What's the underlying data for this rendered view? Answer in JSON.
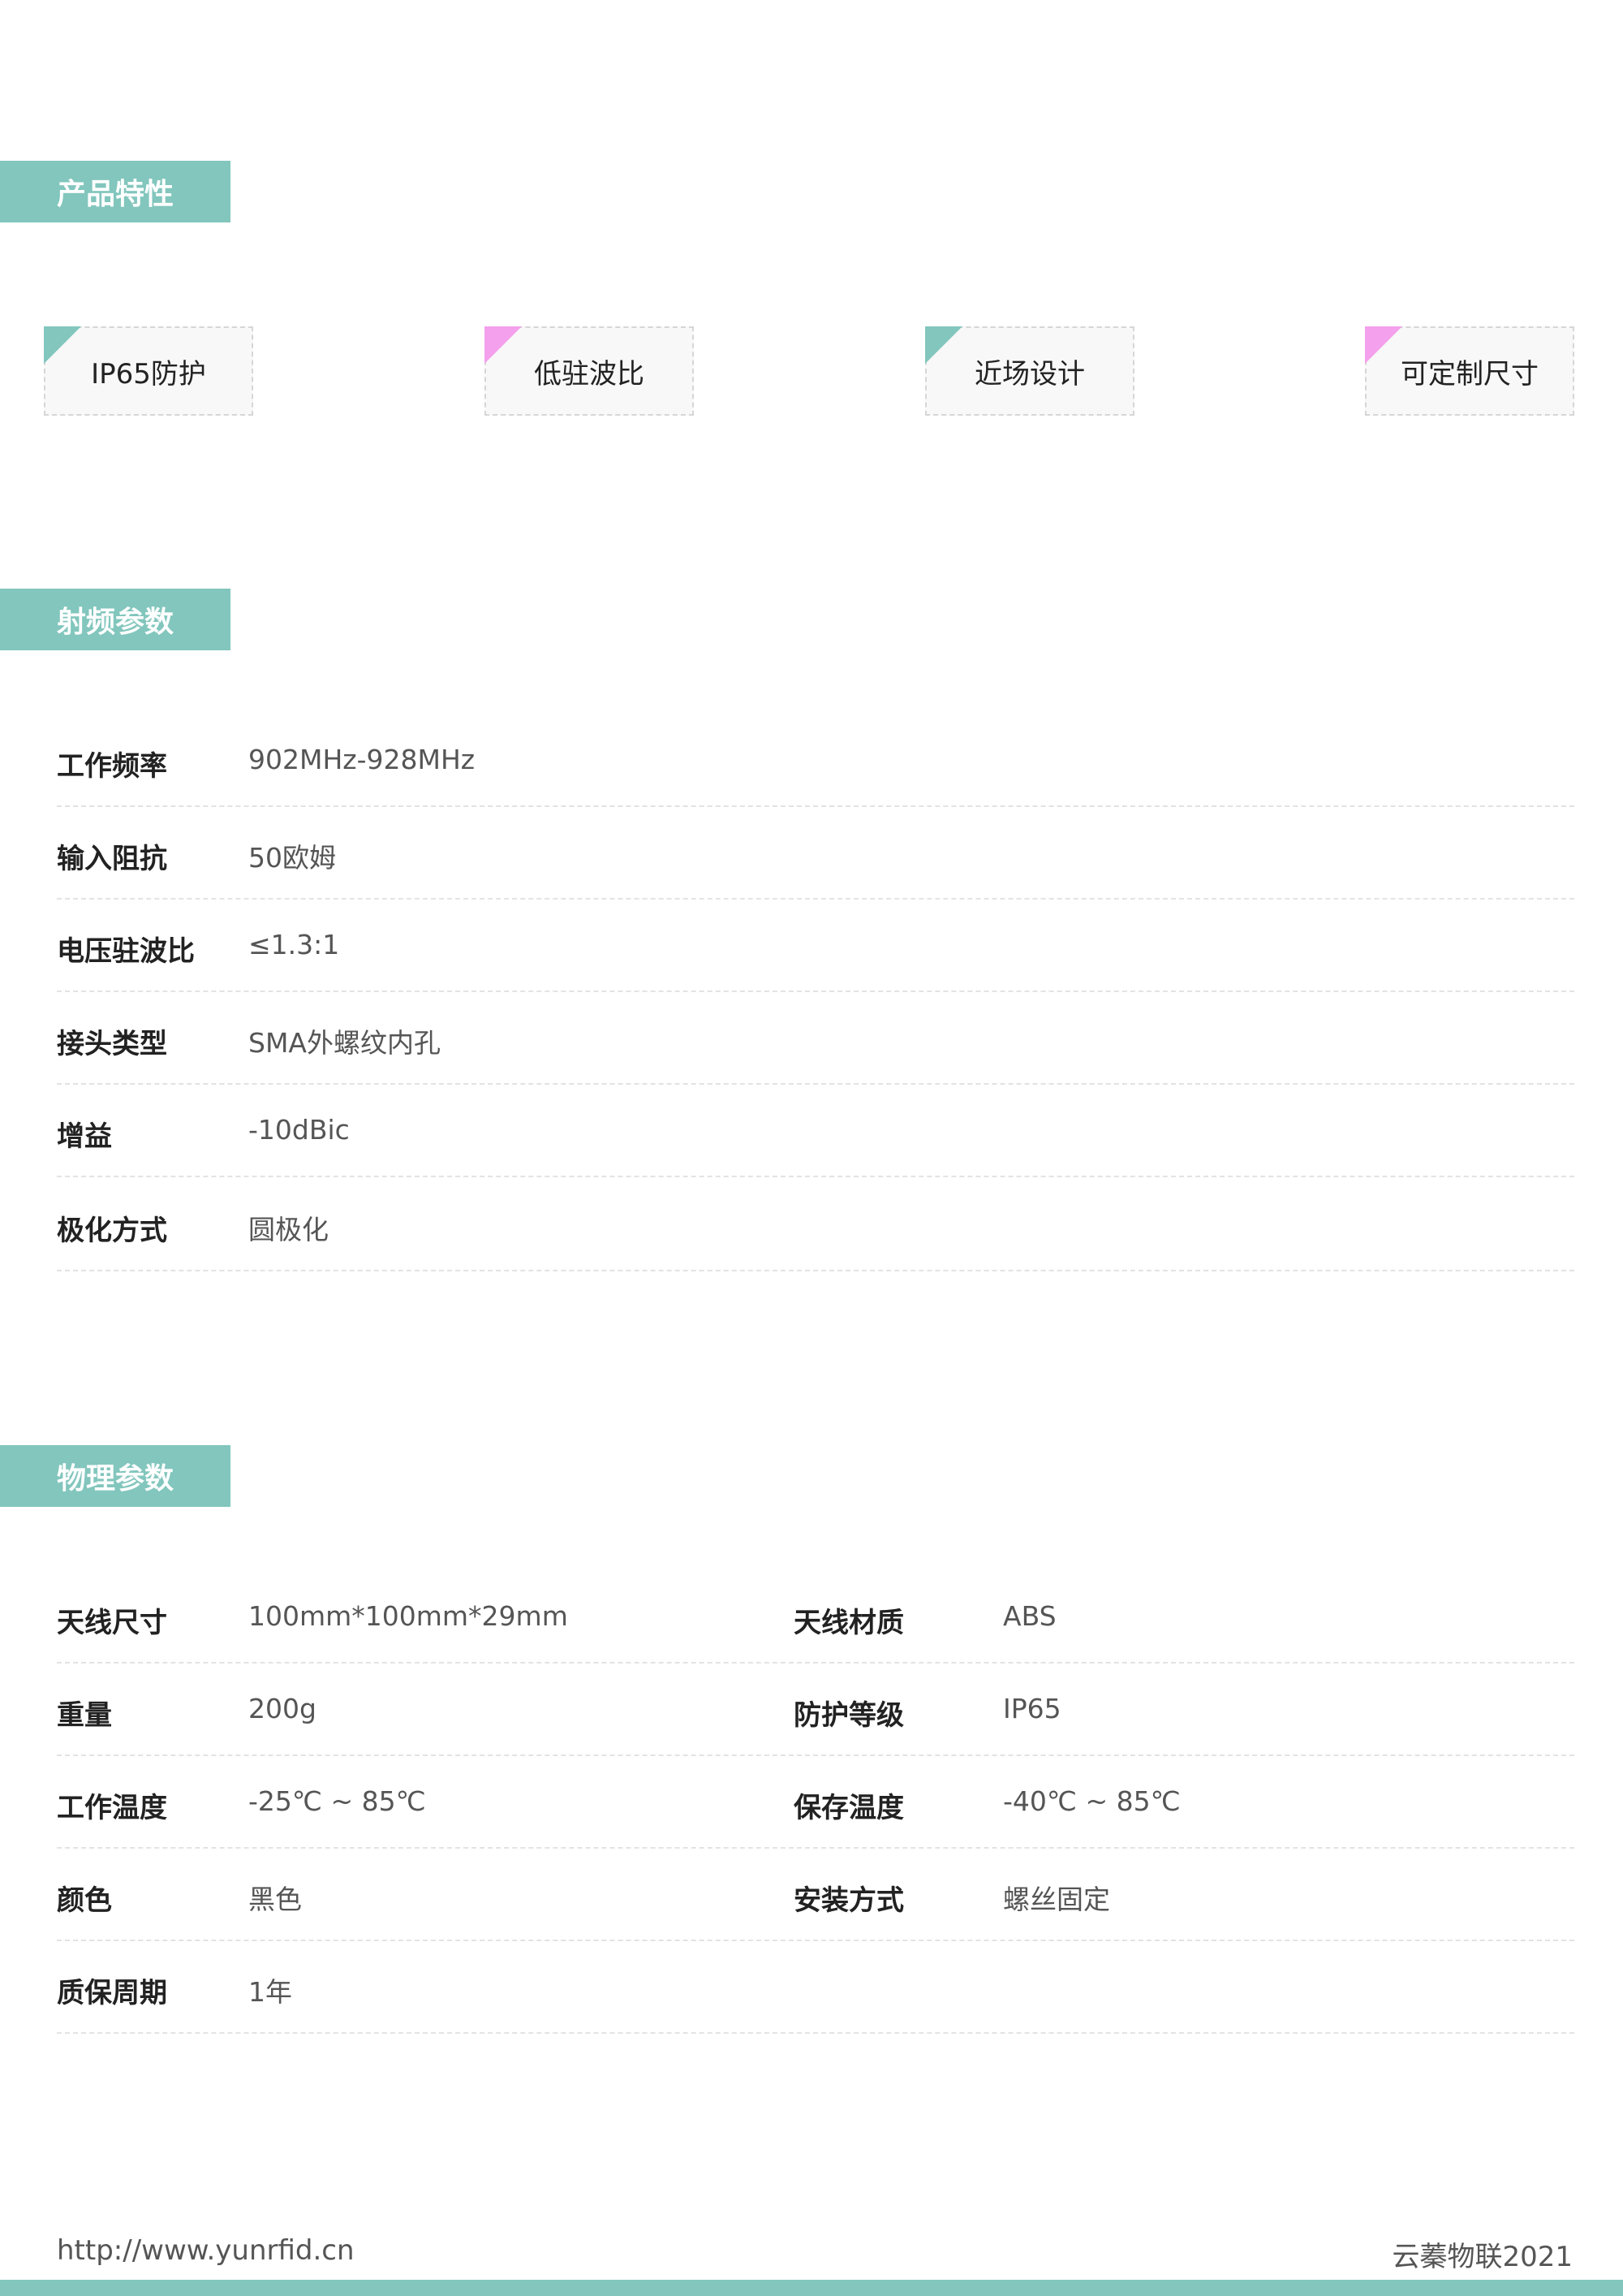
{
  "sections": {
    "features_title": "产品特性",
    "rf_title": "射频参数",
    "physical_title": "物理参数"
  },
  "features": [
    {
      "label": "IP65防护",
      "corner_color": "#82c6bd"
    },
    {
      "label": "低驻波比",
      "corner_color": "#f4a0ec"
    },
    {
      "label": "近场设计",
      "corner_color": "#82c6bd"
    },
    {
      "label": "可定制尺寸",
      "corner_color": "#f4a0ec"
    }
  ],
  "rf_params": [
    {
      "label": "工作频率",
      "value": "902MHz-928MHz"
    },
    {
      "label": "输入阻抗",
      "value": "50欧姆"
    },
    {
      "label": "电压驻波比",
      "value": "≤1.3:1"
    },
    {
      "label": "接头类型",
      "value": "SMA外螺纹内孔"
    },
    {
      "label": "增益",
      "value": "-10dBic"
    },
    {
      "label": "极化方式",
      "value": "圆极化"
    }
  ],
  "physical_params": [
    {
      "l1": "天线尺寸",
      "v1": "100mm*100mm*29mm",
      "l2": "天线材质",
      "v2": "ABS"
    },
    {
      "l1": "重量",
      "v1": "200g",
      "l2": "防护等级",
      "v2": "IP65"
    },
    {
      "l1": "工作温度",
      "v1": "-25℃ ~ 85℃",
      "l2": "保存温度",
      "v2": "-40℃ ~ 85℃"
    },
    {
      "l1": "颜色",
      "v1": "黑色",
      "l2": "安装方式",
      "v2": "螺丝固定"
    },
    {
      "l1": "质保周期",
      "v1": "1年",
      "l2": "",
      "v2": ""
    }
  ],
  "footer": {
    "url": "http://www.yunrfid.cn",
    "brand": "云蓁物联2021"
  },
  "colors": {
    "accent": "#82c6bd",
    "pink": "#f4a0ec"
  }
}
